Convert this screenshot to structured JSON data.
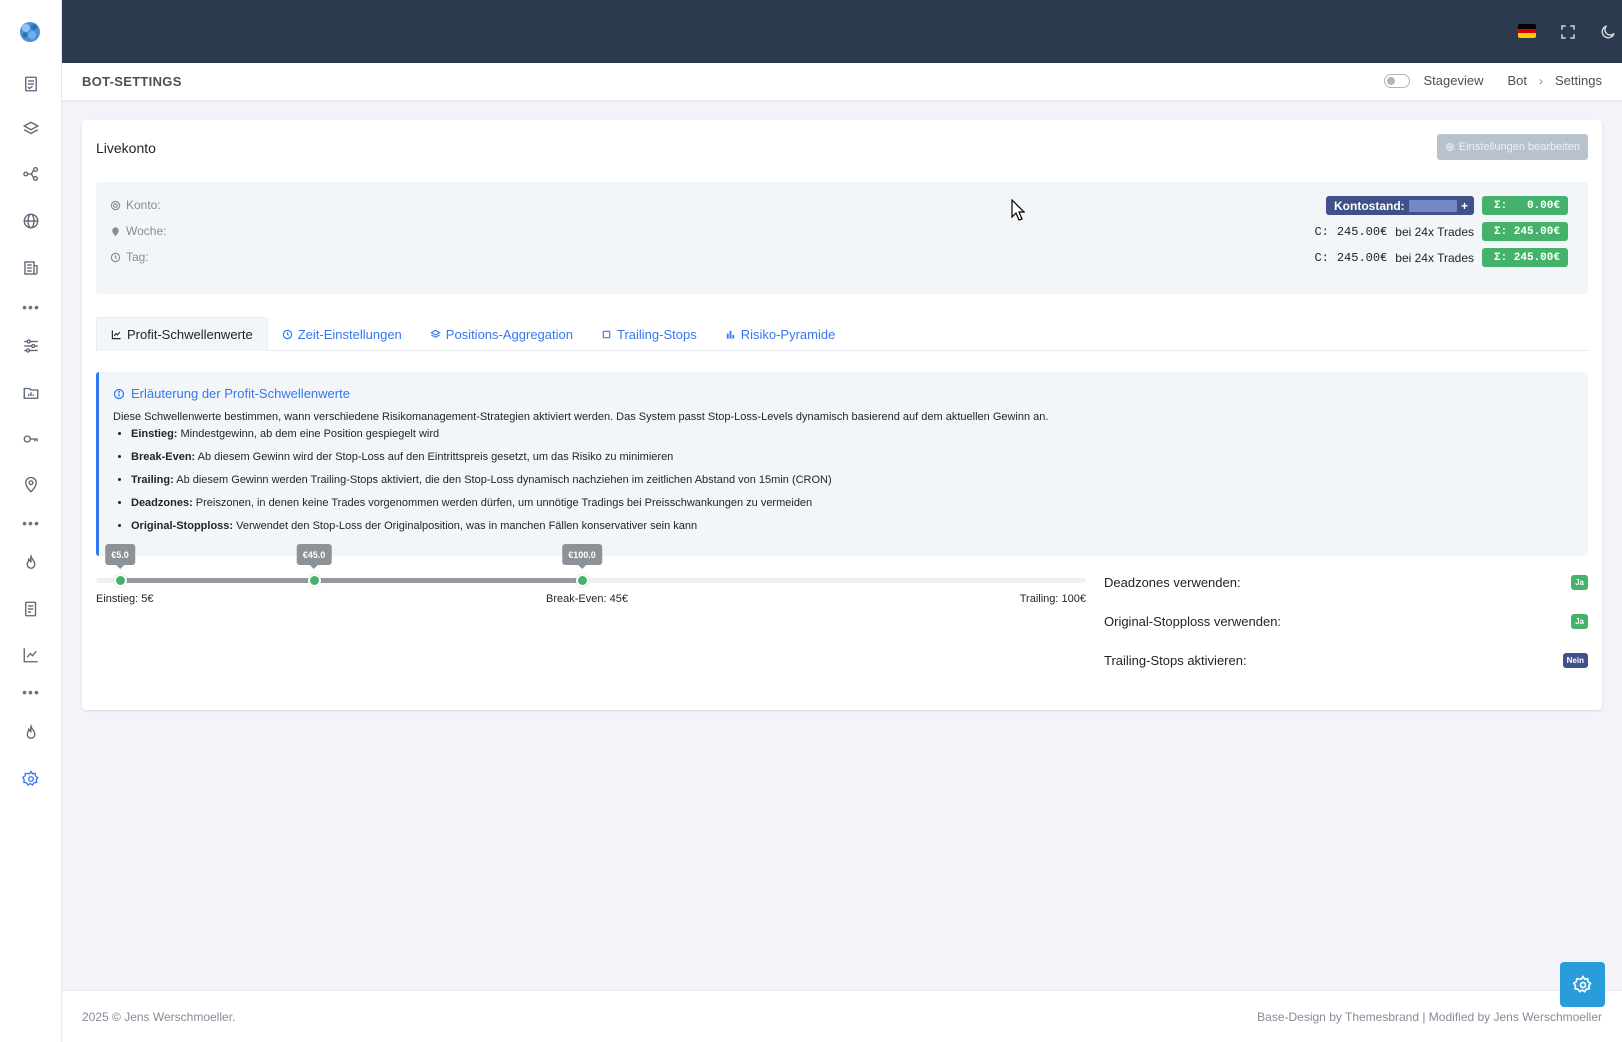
{
  "header": {
    "page_title": "BOT-SETTINGS",
    "stageview_label": "Stageview",
    "breadcrumb": [
      "Bot",
      "Settings"
    ]
  },
  "card": {
    "title": "Livekonto",
    "edit_button": "Einstellungen bearbeiten"
  },
  "summary": {
    "konto_label": "Konto:",
    "woche_label": "Woche:",
    "tag_label": "Tag:",
    "kontostand_label": "Kontostand:",
    "kontostand_plus": "+",
    "sigma": "Σ:",
    "konto_total": "0.00€",
    "woche": {
      "c_label": "C:",
      "c_value": "245.00€",
      "trades": "bei 24x Trades",
      "total": "245.00€"
    },
    "tag": {
      "c_label": "C:",
      "c_value": "245.00€",
      "trades": "bei 24x Trades",
      "total": "245.00€"
    }
  },
  "tabs": [
    {
      "label": "Profit-Schwellenwerte",
      "icon": "line-chart-icon"
    },
    {
      "label": "Zeit-Einstellungen",
      "icon": "clock-icon"
    },
    {
      "label": "Positions-Aggregation",
      "icon": "layers-icon"
    },
    {
      "label": "Trailing-Stops",
      "icon": "square-icon"
    },
    {
      "label": "Risiko-Pyramide",
      "icon": "bar-chart-icon"
    }
  ],
  "info": {
    "title": "Erläuterung der Profit-Schwellenwerte",
    "description": "Diese Schwellenwerte bestimmen, wann verschiedene Risikomanagement-Strategien aktiviert werden. Das System passt Stop-Loss-Levels dynamisch basierend auf dem aktuellen Gewinn an.",
    "items": [
      {
        "term": "Einstieg:",
        "text": " Mindestgewinn, ab dem eine Position gespiegelt wird"
      },
      {
        "term": "Break-Even:",
        "text": " Ab diesem Gewinn wird der Stop-Loss auf den Eintrittspreis gesetzt, um das Risiko zu minimieren"
      },
      {
        "term": "Trailing:",
        "text": " Ab diesem Gewinn werden Trailing-Stops aktiviert, die den Stop-Loss dynamisch nachziehen im zeitlichen Abstand von 15min (CRON)"
      },
      {
        "term": "Deadzones:",
        "text": " Preiszonen, in denen keine Trades vorgenommen werden dürfen, um unnötige Tradings bei Preisschwankungen zu vermeiden"
      },
      {
        "term": "Original-Stopploss:",
        "text": " Verwendet den Stop-Loss der Originalposition, was in manchen Fällen konservativer sein kann"
      }
    ]
  },
  "slider": {
    "min": 0,
    "max": 200,
    "handles": [
      {
        "value": 5.0,
        "tooltip": "€5.0"
      },
      {
        "value": 45.0,
        "tooltip": "€45.0"
      },
      {
        "value": 100.0,
        "tooltip": "€100.0"
      }
    ],
    "labels": {
      "einstieg": "Einstieg: 5€",
      "break_even": "Break-Even: 45€",
      "trailing": "Trailing: 100€"
    }
  },
  "options": [
    {
      "label": "Deadzones verwenden:",
      "value": "Ja",
      "color": "#45b26b"
    },
    {
      "label": "Original-Stopploss verwenden:",
      "value": "Ja",
      "color": "#45b26b"
    },
    {
      "label": "Trailing-Stops aktivieren:",
      "value": "Nein",
      "color": "#405189"
    }
  ],
  "footer": {
    "left": "2025 © Jens Werschmoeller.",
    "right": "Base-Design by Themesbrand | Modified by Jens Werschmoeller"
  },
  "colors": {
    "topbar": "#2c3a4d",
    "accent": "#3577f1",
    "success": "#45b26b",
    "primary": "#405189"
  }
}
